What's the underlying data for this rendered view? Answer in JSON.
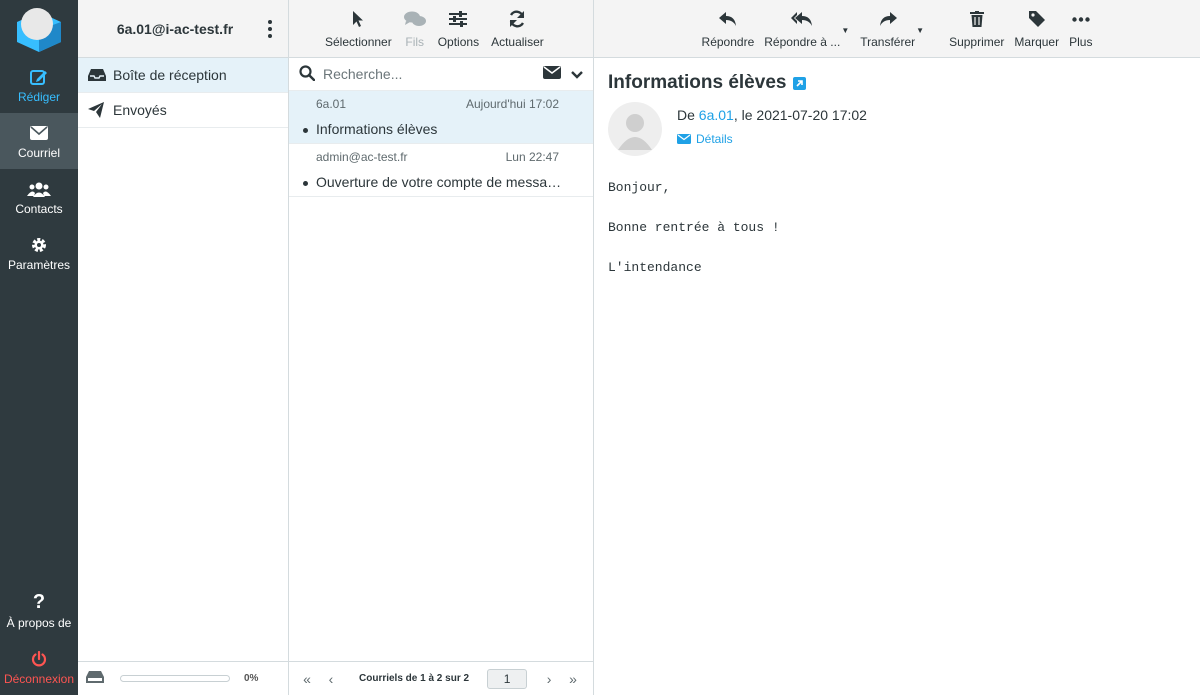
{
  "colors": {
    "nav_bg": "#2f3a3f",
    "accent": "#1fa1e6",
    "compose": "#37beff",
    "logout": "#ff5552",
    "selected": "#e5f2f9"
  },
  "nav": {
    "compose": "Rédiger",
    "mail": "Courriel",
    "contacts": "Contacts",
    "settings": "Paramètres",
    "about": "À propos de",
    "logout": "Déconnexion"
  },
  "folders": {
    "account": "6a.01@i-ac-test.fr",
    "items": [
      {
        "label": "Boîte de réception",
        "icon": "inbox-icon"
      },
      {
        "label": "Envoyés",
        "icon": "paper-plane-icon"
      }
    ],
    "quota": "0%",
    "quota_fraction": 0
  },
  "list_toolbar": {
    "select": "Sélectionner",
    "threads": "Fils",
    "options": "Options",
    "refresh": "Actualiser"
  },
  "search": {
    "placeholder": "Recherche..."
  },
  "messages": [
    {
      "from": "6a.01",
      "date": "Aujourd'hui 17:02",
      "subject": "Informations élèves"
    },
    {
      "from": "admin@ac-test.fr",
      "date": "Lun 22:47",
      "subject": "Ouverture de votre compte de messagerie"
    }
  ],
  "pagination": {
    "count": "Courriels de 1 à 2 sur 2",
    "page": "1"
  },
  "view_toolbar": {
    "reply": "Répondre",
    "reply_all": "Répondre à ...",
    "forward": "Transférer",
    "delete": "Supprimer",
    "mark": "Marquer",
    "more": "Plus"
  },
  "mail": {
    "subject": "Informations élèves",
    "from_prefix": "De ",
    "from": "6a.01",
    "date_suffix": ", le 2021-07-20 17:02",
    "details": "Détails",
    "body": [
      "Bonjour,",
      "Bonne rentrée à tous !",
      "L'intendance"
    ]
  }
}
